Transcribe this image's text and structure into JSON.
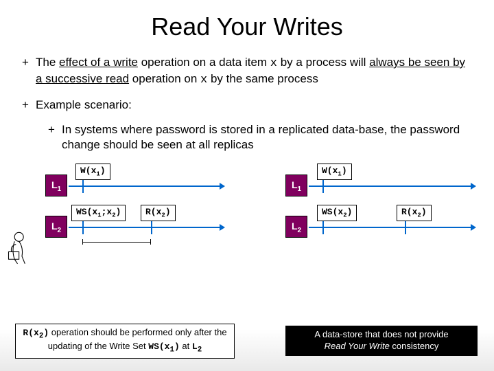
{
  "title": "Read Your Writes",
  "bullet1_pre": "The ",
  "bullet1_u1": "effect of a write",
  "bullet1_mid1": " operation on a data item ",
  "bullet1_x1": "x",
  "bullet1_mid2": " by a process will ",
  "bullet1_u2": "always be seen by a successive read",
  "bullet1_mid3": " operation on ",
  "bullet1_x2": "x",
  "bullet1_end": " by the same process",
  "bullet2": "Example scenario:",
  "bullet2a": "In systems where password is stored in a replicated data-base, the password change should be seen at all replicas",
  "left": {
    "L1": "L",
    "L1s": "1",
    "L2": "L",
    "L2s": "2",
    "op1": "W(x",
    "op1s": "1",
    "op1e": ")",
    "op2a": "WS(x",
    "op2as": "1",
    "op2m": ";x",
    "op2bs": "2",
    "op2e": ")",
    "op3": "R(x",
    "op3s": "2",
    "op3e": ")"
  },
  "right": {
    "L1": "L",
    "L1s": "1",
    "L2": "L",
    "L2s": "2",
    "op1": "W(x",
    "op1s": "1",
    "op1e": ")",
    "op2": "WS(x",
    "op2s": "2",
    "op2e": ")",
    "op3": "R(x",
    "op3s": "2",
    "op3e": ")"
  },
  "caption_left_a": "R(x",
  "caption_left_as": "2",
  "caption_left_b": ")",
  "caption_left_1": " operation should be performed only after the updating of the Write Set ",
  "caption_left_c": "WS(x",
  "caption_left_cs": "1",
  "caption_left_d": ")",
  "caption_left_2": " at ",
  "caption_left_e": "L",
  "caption_left_es": "2",
  "caption_right_1": "A data-store that does not provide",
  "caption_right_2": "Read Your Write",
  "caption_right_3": " consistency",
  "plus": "+"
}
